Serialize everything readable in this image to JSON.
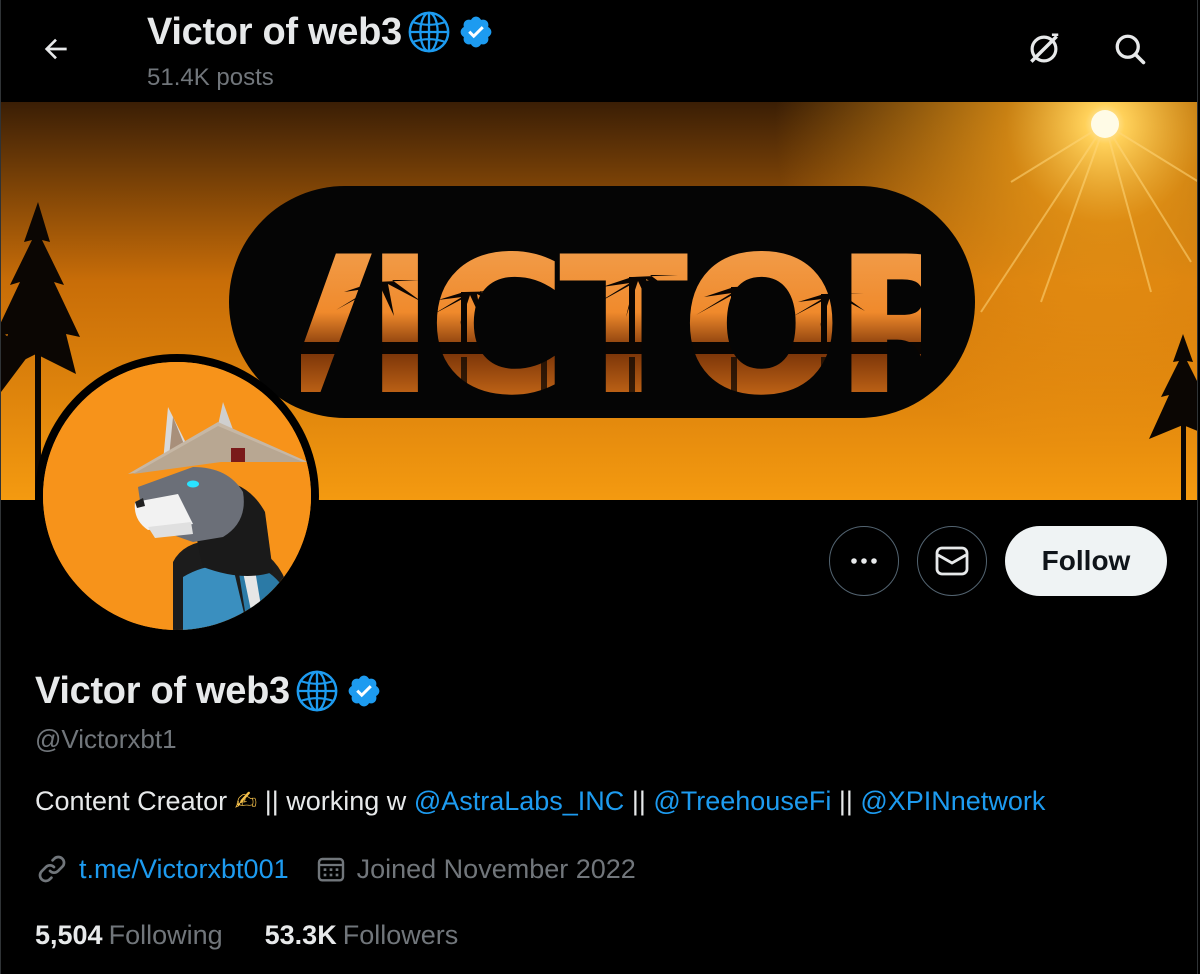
{
  "header": {
    "name": "Victor of web3",
    "posts": "51.4K posts"
  },
  "banner": {
    "text": "VICTOR"
  },
  "actions": {
    "follow_label": "Follow"
  },
  "profile": {
    "name": "Victor of web3",
    "handle": "@Victorxbt1",
    "bio": {
      "prefix": "Content Creator ",
      "emoji": "✍",
      "middle": " || working w ",
      "mention1": "@AstraLabs_INC",
      "sep1": " || ",
      "mention2": "@TreehouseFi",
      "sep2": " || ",
      "mention3": "@XPINnetwork"
    },
    "link": "t.me/Victorxbt001",
    "joined": "Joined November 2022",
    "following_count": "5,504",
    "following_label": "Following",
    "followers_count": "53.3K",
    "followers_label": "Followers"
  },
  "colors": {
    "accent": "#1d9bf0",
    "banner_orange": "#f7931a",
    "muted": "#71767b"
  },
  "icons": [
    "back-arrow-icon",
    "globe-icon",
    "verified-badge-icon",
    "grok-icon",
    "search-icon",
    "more-icon",
    "message-icon",
    "link-icon",
    "calendar-icon"
  ]
}
